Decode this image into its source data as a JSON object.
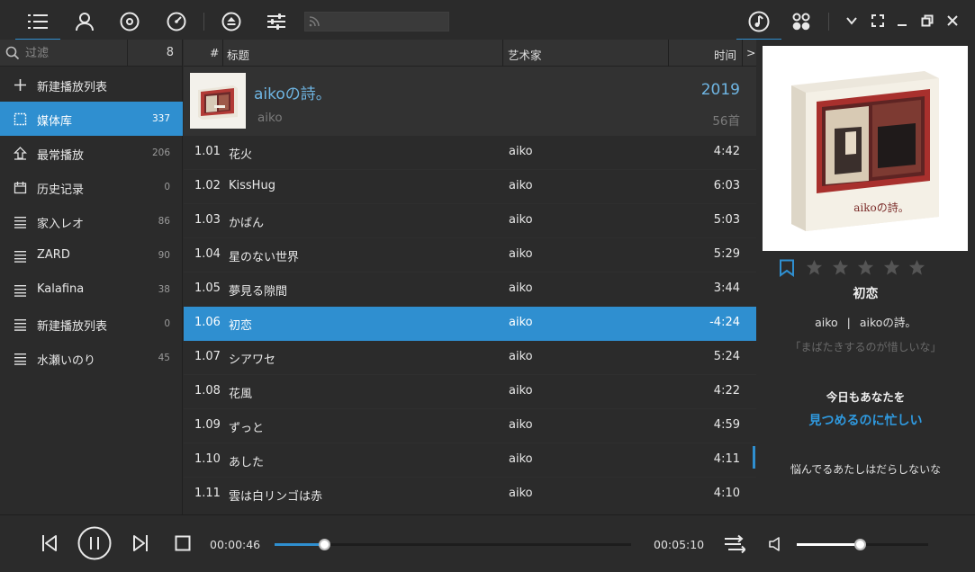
{
  "toolbar": {
    "items": [
      {
        "icon": "list-icon",
        "active": true
      },
      {
        "icon": "person-icon",
        "active": false
      },
      {
        "icon": "disc-icon",
        "active": false
      },
      {
        "icon": "gauge-icon",
        "active": false
      },
      {
        "icon": "eject-icon",
        "active": false
      },
      {
        "icon": "equalizer-icon",
        "active": false
      }
    ],
    "search_placeholder": "",
    "right_items": [
      {
        "icon": "music-note-icon",
        "active": true
      },
      {
        "icon": "grid-icon",
        "active": false
      }
    ]
  },
  "sidebar": {
    "filter_placeholder": "过滤",
    "filter_count": "8",
    "items": [
      {
        "label": "新建播放列表",
        "count": "",
        "icon": "plus-icon"
      },
      {
        "label": "媒体库",
        "count": "337",
        "icon": "library-icon",
        "active": true
      },
      {
        "label": "最常播放",
        "count": "206",
        "icon": "arrow-up-icon"
      },
      {
        "label": "历史记录",
        "count": "0",
        "icon": "calendar-icon"
      },
      {
        "label": "家入レオ",
        "count": "86",
        "icon": "playlist-icon"
      },
      {
        "label": "ZARD",
        "count": "90",
        "icon": "playlist-icon"
      },
      {
        "label": "Kalafina",
        "count": "38",
        "icon": "playlist-icon"
      },
      {
        "label": "新建播放列表",
        "count": "0",
        "icon": "playlist-icon"
      },
      {
        "label": "水瀬いのり",
        "count": "45",
        "icon": "playlist-icon"
      }
    ]
  },
  "list": {
    "headers": {
      "num": "#",
      "title": "标题",
      "artist": "艺术家",
      "time": "时间",
      "more": ">"
    },
    "album": {
      "name": "aikoの詩。",
      "artist": "aiko",
      "year": "2019",
      "count": "56首"
    },
    "tracks": [
      {
        "num": "1.01",
        "title": "花火",
        "artist": "aiko",
        "time": "4:42"
      },
      {
        "num": "1.02",
        "title": "KissHug",
        "artist": "aiko",
        "time": "6:03"
      },
      {
        "num": "1.03",
        "title": "かばん",
        "artist": "aiko",
        "time": "5:03"
      },
      {
        "num": "1.04",
        "title": "星のない世界",
        "artist": "aiko",
        "time": "5:29"
      },
      {
        "num": "1.05",
        "title": "夢見る隙間",
        "artist": "aiko",
        "time": "3:44"
      },
      {
        "num": "1.06",
        "title": "初恋",
        "artist": "aiko",
        "time": "-4:24",
        "selected": true
      },
      {
        "num": "1.07",
        "title": "シアワセ",
        "artist": "aiko",
        "time": "5:24"
      },
      {
        "num": "1.08",
        "title": "花風",
        "artist": "aiko",
        "time": "4:22"
      },
      {
        "num": "1.09",
        "title": "ずっと",
        "artist": "aiko",
        "time": "4:59"
      },
      {
        "num": "1.10",
        "title": "あした",
        "artist": "aiko",
        "time": "4:11"
      },
      {
        "num": "1.11",
        "title": "雲は白リンゴは赤",
        "artist": "aiko",
        "time": "4:10"
      }
    ]
  },
  "now_playing": {
    "cover_text": "aikoの詩。",
    "rating": 0,
    "rating_max": 5,
    "title": "初恋",
    "artist": "aiko",
    "separator": "|",
    "album": "aikoの詩。",
    "lyrics": [
      "「まばたきするのが惜しいな」",
      "今日もあなたを",
      "見つめるのに忙しい",
      "悩んでるあたしはだらしないな"
    ]
  },
  "player": {
    "current_time": "00:00:46",
    "total_time": "00:05:10",
    "progress": 0.14,
    "volume": 0.48
  },
  "colors": {
    "accent": "#2f8fd0",
    "lyric_highlight": "#2f9ae0",
    "background": "#2b2b2b"
  }
}
